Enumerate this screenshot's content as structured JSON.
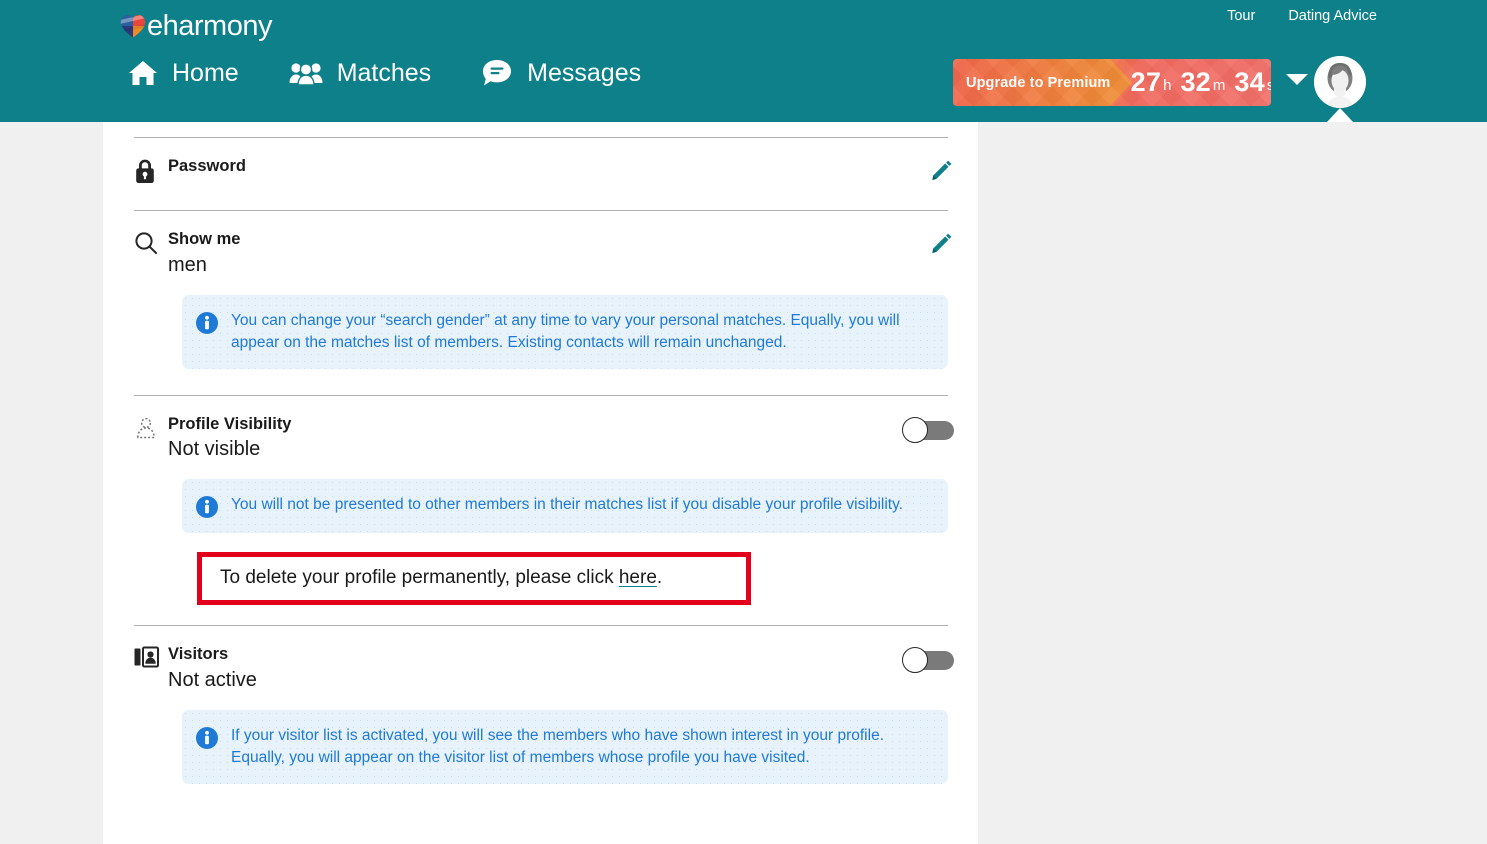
{
  "brand": {
    "name": "eharmony",
    "logo_icon": "heart-logo-icon",
    "color": "#0e8089"
  },
  "header": {
    "background_color": "#0e8089",
    "top_links": [
      {
        "label": "Tour",
        "name": "tour-link"
      },
      {
        "label": "Dating Advice",
        "name": "dating-advice-link"
      }
    ],
    "nav": [
      {
        "label": "Home",
        "icon": "home-icon"
      },
      {
        "label": "Matches",
        "icon": "people-icon"
      },
      {
        "label": "Messages",
        "icon": "chat-bubble-icon"
      }
    ],
    "upgrade": {
      "label": "Upgrade to Premium",
      "hours": "27",
      "hours_unit": "h",
      "minutes": "32",
      "minutes_unit": "m",
      "seconds": "34",
      "seconds_unit": "s",
      "accent_color": "#f2694a"
    },
    "account": {
      "caret_icon": "chevron-down-icon",
      "avatar_icon": "user-avatar-icon"
    }
  },
  "settings": {
    "password": {
      "icon": "lock-icon",
      "title": "Password",
      "edit_icon": "pencil-icon"
    },
    "show_me": {
      "icon": "search-icon",
      "title": "Show me",
      "value": "men",
      "edit_icon": "pencil-icon",
      "info": "You can change your “search gender” at any time to vary your personal matches. Equally, you will appear on the matches list of members. Existing contacts will remain unchanged."
    },
    "profile_visibility": {
      "icon": "hidden-user-icon",
      "title": "Profile Visibility",
      "value": "Not visible",
      "toggle_state": "off",
      "info": "You will not be presented to other members in their matches list if you disable your profile visibility.",
      "delete_notice": {
        "text_before": "To delete your profile permanently, please click ",
        "link_label": "here",
        "text_after": ".",
        "highlight_color": "#e3001b"
      }
    },
    "visitors": {
      "icon": "visitors-door-icon",
      "title": "Visitors",
      "value": "Not active",
      "toggle_state": "off",
      "info": "If your visitor list is activated, you will see the members who have shown interest in your profile. Equally, you will appear on the visitor list of members whose profile you have visited."
    }
  }
}
